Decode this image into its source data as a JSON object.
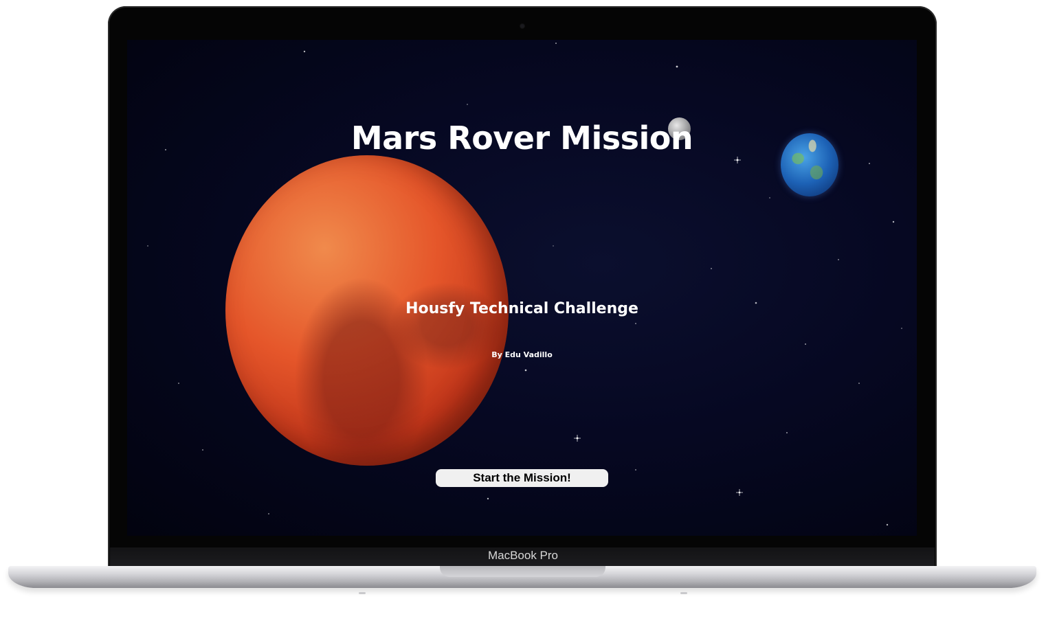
{
  "device": {
    "brand_label": "MacBook Pro"
  },
  "app": {
    "title": "Mars Rover Mission",
    "subtitle": "Housfy Technical Challenge",
    "byline": "By Edu Vadillo",
    "start_button_label": "Start the Mission!"
  },
  "colors": {
    "background": "#060822",
    "mars": "#e5562a",
    "text": "#ffffff",
    "button_bg": "#f0f0f0"
  }
}
